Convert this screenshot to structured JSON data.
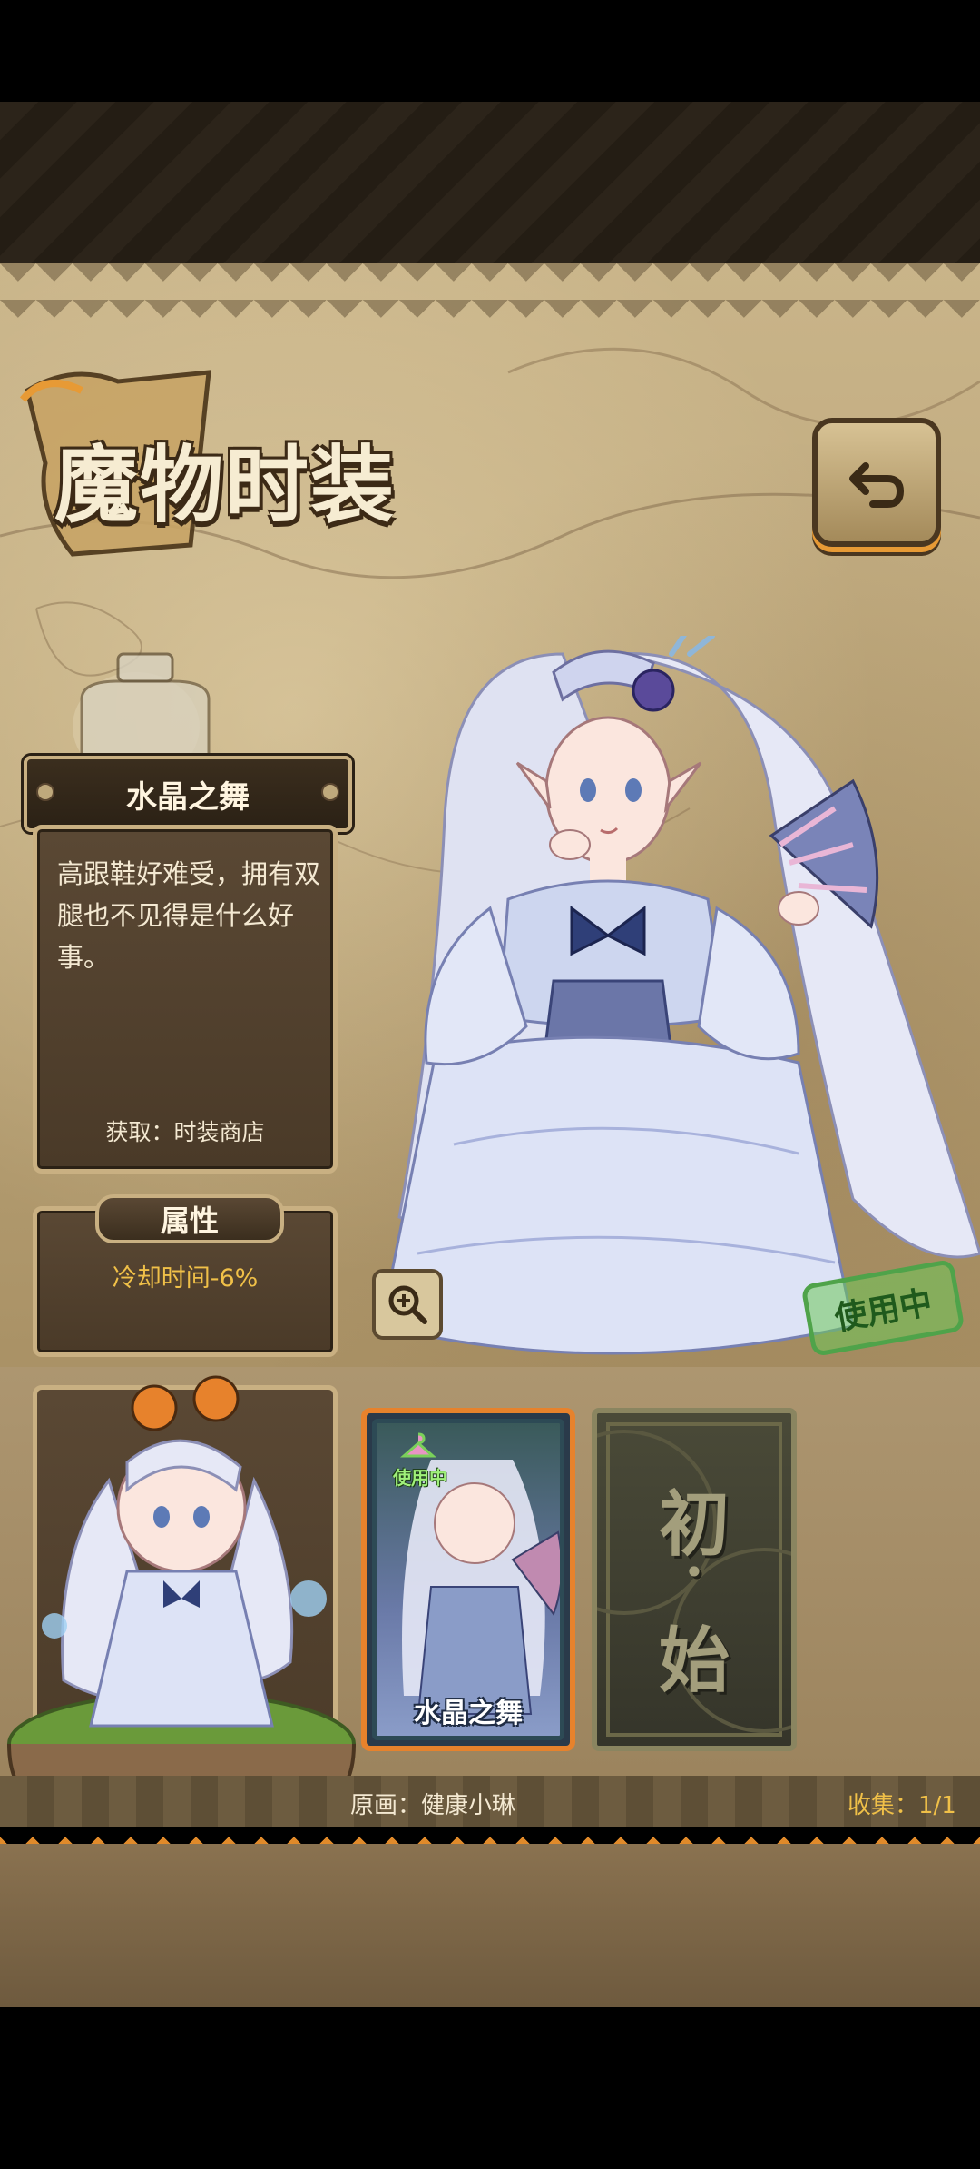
{
  "header": {
    "title": "魔物时装"
  },
  "costume": {
    "name": "水晶之舞",
    "description": "高跟鞋好难受，拥有双腿也不见得是什么好事。",
    "source": "获取：时装商店"
  },
  "attributes": {
    "header": "属性",
    "value": "冷却时间-6%"
  },
  "status": {
    "stamp": "使用中"
  },
  "cards": [
    {
      "label": "水晶之舞",
      "badge": "使用中",
      "selected": true
    },
    {
      "label_top": "初",
      "label_mid": "·",
      "label_bottom": "始",
      "selected": false
    }
  ],
  "footer": {
    "artist": "原画：健康小琳",
    "collection": "收集：1/1"
  },
  "icons": {
    "back": "back-arrow-icon",
    "zoom": "zoom-in-icon",
    "hanger": "hanger-icon"
  },
  "colors": {
    "accent_orange": "#e7822c",
    "attribute_text": "#f0c048",
    "stamp_green": "#4fa34a"
  }
}
